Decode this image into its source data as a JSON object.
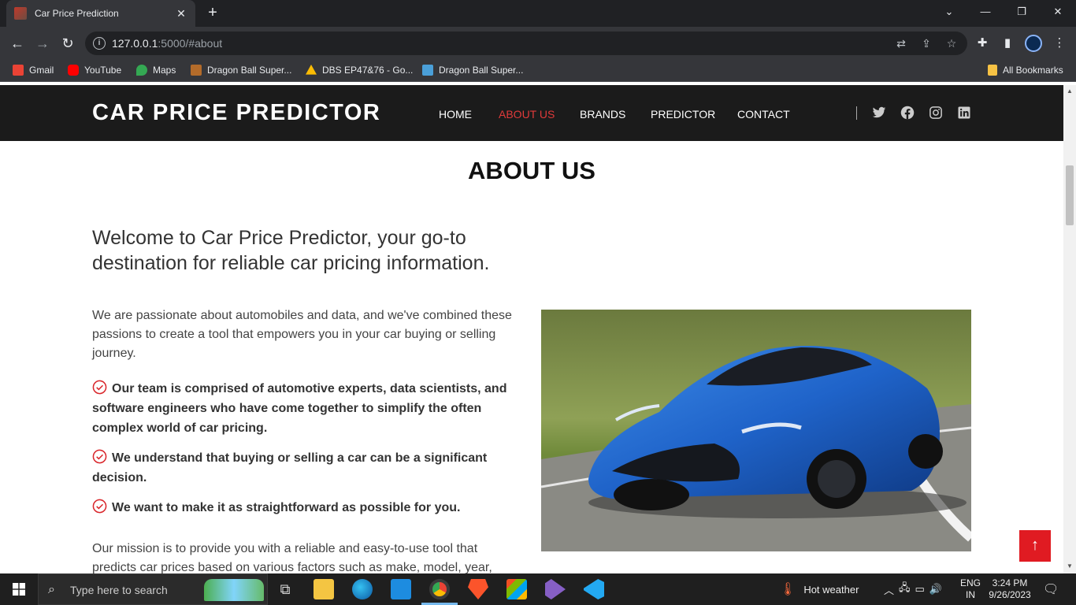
{
  "browser": {
    "tab_title": "Car Price Prediction",
    "tab_close": "✕",
    "new_tab": "+",
    "url_host": "127.0.0.1",
    "url_rest": ":5000/#about",
    "window": {
      "minimize": "—",
      "restore": "❐",
      "close": "✕",
      "tabsearch": "⌄"
    },
    "bookmarks": [
      {
        "label": "Gmail",
        "color": "#ea4335"
      },
      {
        "label": "YouTube",
        "color": "#ff0000"
      },
      {
        "label": "Maps",
        "color": "#34a853"
      },
      {
        "label": "Dragon Ball Super...",
        "color": "#b36b2a"
      },
      {
        "label": "DBS EP47&76 - Go...",
        "color": "#fbbc04"
      },
      {
        "label": "Dragon Ball Super...",
        "color": "#4a9fd8"
      }
    ],
    "all_bookmarks": "All Bookmarks"
  },
  "site": {
    "logo": "CAR PRICE PREDICTOR",
    "nav": [
      "HOME",
      "ABOUT US",
      "BRANDS",
      "PREDICTOR",
      "CONTACT"
    ],
    "active_nav": "ABOUT US",
    "accent_color": "#e03a3a"
  },
  "about": {
    "title": "ABOUT US",
    "lead": "Welcome to Car Price Predictor, your go-to destination for reliable car pricing information.",
    "intro": "We are passionate about automobiles and data, and we've combined these passions to create a tool that empowers you in your car buying or selling journey.",
    "points": [
      "Our team is comprised of automotive experts, data scientists, and software engineers who have come together to simplify the often complex world of car pricing.",
      "We understand that buying or selling a car can be a significant decision.",
      "We want to make it as straightforward as possible for you."
    ],
    "mission": "Our mission is to provide you with a reliable and easy-to-use tool that predicts car prices based on various factors such as make, model, year,",
    "back_to_top": "↑"
  },
  "taskbar": {
    "search_placeholder": "Type here to search",
    "weather": "Hot weather",
    "lang_1": "ENG",
    "lang_2": "IN",
    "time": "3:24 PM",
    "date": "9/26/2023"
  }
}
